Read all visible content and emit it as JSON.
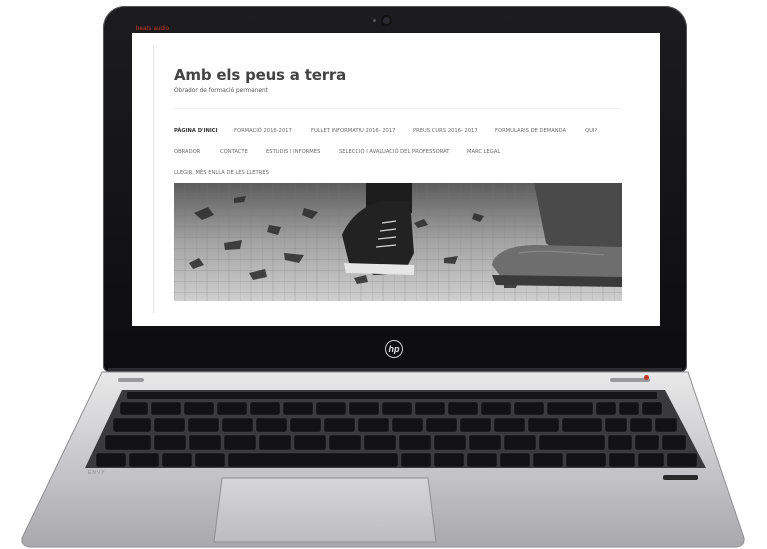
{
  "device": {
    "brand_badge": "beats audio",
    "hp_logo": "hp",
    "model_label": "ENVY"
  },
  "site": {
    "title": "Amb els peus a terra",
    "tagline": "Obrador de formació permanent"
  },
  "nav": {
    "items": [
      {
        "label": "PÀGINA D'INICI",
        "active": true
      },
      {
        "label": "FORMACIÓ 2016-2017",
        "active": false
      },
      {
        "label": "FULLET INFORMATIU 2016- 2017",
        "active": false
      },
      {
        "label": "PREUS CURS 2016- 2017",
        "active": false
      },
      {
        "label": "FORMULARIS DE DEMANDA",
        "active": false
      },
      {
        "label": "QUI?",
        "active": false
      },
      {
        "label": "OBRADOR",
        "active": false
      },
      {
        "label": "CONTACTE",
        "active": false
      },
      {
        "label": "ESTUDIS I INFORMES",
        "active": false
      },
      {
        "label": "SELECCIÓ I AVALUACIÓ DEL PROFESSORAT",
        "active": false
      },
      {
        "label": "MARC LEGAL",
        "active": false
      },
      {
        "label": "LLEGIR, MÉS ENLLÀ DE LES LLETRES",
        "active": false
      }
    ]
  },
  "colors": {
    "title": "#444444",
    "nav_text": "#6b6b6b",
    "led": "#c0392b",
    "bezel": "#111111",
    "chassis": "#c8c8ca"
  }
}
